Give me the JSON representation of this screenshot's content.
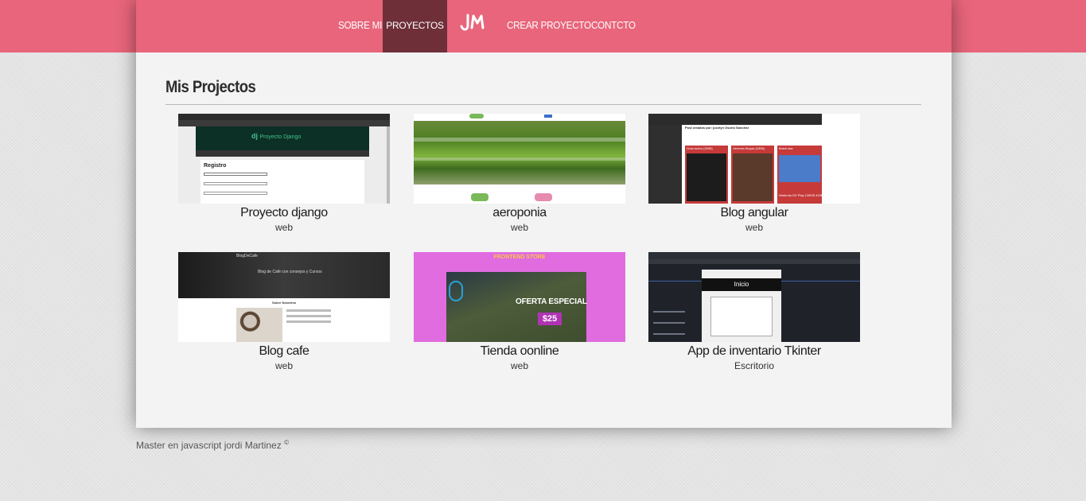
{
  "nav": {
    "items": [
      "SOBRE MI",
      "PROYECTOS",
      "CREAR PROYECTO",
      "CONTCTO"
    ],
    "active": "PROYECTOS",
    "logo": "JM",
    "color": "#e8657b",
    "active_color": "#6e2f39"
  },
  "main": {
    "title": "Mis Projectos",
    "projects": [
      {
        "name": "Proyecto django",
        "category": "web",
        "thumb_text": "Proyecto Django",
        "thumb_heading": "Registro"
      },
      {
        "name": "aeroponia",
        "category": "web"
      },
      {
        "name": "Blog angular",
        "category": "web",
        "thumb_heading": "Post creados por: jocelyn Osorio Sanchez",
        "thumb_cards": [
          "Gran torino (2008)",
          "Jóvenes Brujas (1996)",
          "Brawl star"
        ],
        "thumb_extra": "Nintendo DS Play 128GB 4GB - Azul"
      },
      {
        "name": "Blog cafe",
        "category": "web",
        "thumb_text": "BlogDeCafe",
        "thumb_heading": "Blog de Café con consejos y Cursos",
        "thumb_sub": "Sobre Nosotros"
      },
      {
        "name": "Tienda oonline",
        "category": "web",
        "thumb_brand": "FRONTEND STORE",
        "thumb_offer": "OFERTA ESPECIAL",
        "thumb_price": "$25"
      },
      {
        "name": "App de inventario Tkinter",
        "category": "Escritorio",
        "thumb_heading": "Inicio"
      }
    ]
  },
  "footer": {
    "text": "Master en javascript jordi Martinez",
    "symbol": "©"
  }
}
